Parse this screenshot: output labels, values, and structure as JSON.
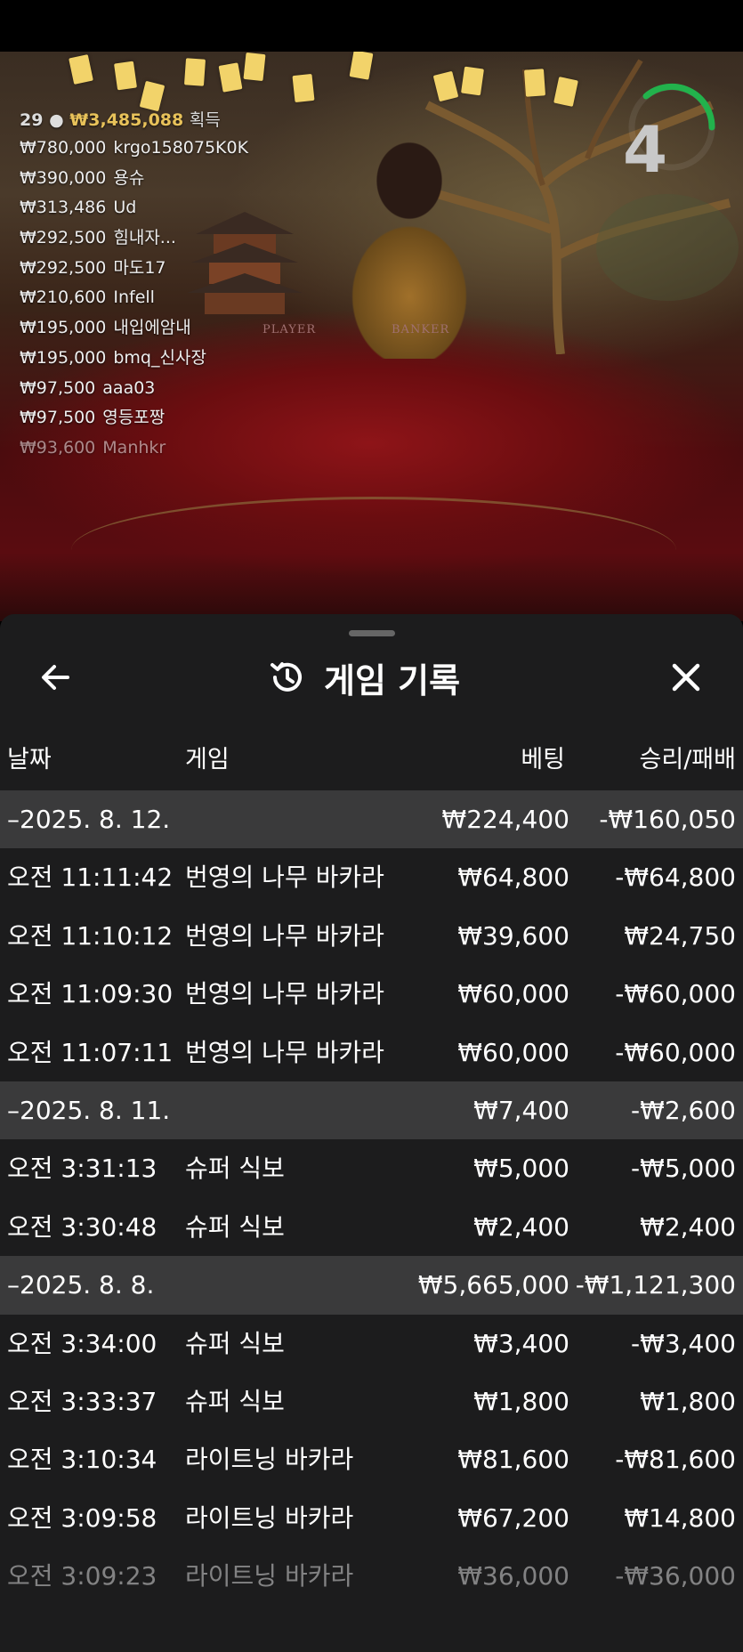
{
  "live": {
    "winners_count": "29",
    "winners_total": "₩3,485,088",
    "winners_label": "획득",
    "countdown": "4",
    "table_labels": [
      "PLAYER",
      "BANKER"
    ],
    "winners": [
      {
        "amount": "₩780,000",
        "name": "krgo158075K0K"
      },
      {
        "amount": "₩390,000",
        "name": "용슈"
      },
      {
        "amount": "₩313,486",
        "name": "Ud"
      },
      {
        "amount": "₩292,500",
        "name": "힘내자..."
      },
      {
        "amount": "₩292,500",
        "name": "마도17"
      },
      {
        "amount": "₩210,600",
        "name": "Infell"
      },
      {
        "amount": "₩195,000",
        "name": "내입에암내"
      },
      {
        "amount": "₩195,000",
        "name": "bmq_신사장"
      },
      {
        "amount": "₩97,500",
        "name": "aaa03"
      },
      {
        "amount": "₩97,500",
        "name": "영등포짱"
      },
      {
        "amount": "₩93,600",
        "name": "Manhkr"
      }
    ]
  },
  "panel": {
    "title": "게임 기록",
    "back_icon": "arrow-left-icon",
    "history_icon": "history-clock-icon",
    "close_icon": "close-icon",
    "columns": {
      "date": "날짜",
      "game": "게임",
      "bet": "베팅",
      "result": "승리/패배"
    },
    "rows": [
      {
        "type": "date",
        "time": "–2025. 8. 12.",
        "game": "",
        "bet": "₩224,400",
        "result": "-₩160,050"
      },
      {
        "type": "game",
        "time": "오전 11:11:42",
        "game": "번영의 나무 바카라",
        "bet": "₩64,800",
        "result": "-₩64,800"
      },
      {
        "type": "game",
        "time": "오전 11:10:12",
        "game": "번영의 나무 바카라",
        "bet": "₩39,600",
        "result": "₩24,750"
      },
      {
        "type": "game",
        "time": "오전 11:09:30",
        "game": "번영의 나무 바카라",
        "bet": "₩60,000",
        "result": "-₩60,000"
      },
      {
        "type": "game",
        "time": "오전 11:07:11",
        "game": "번영의 나무 바카라",
        "bet": "₩60,000",
        "result": "-₩60,000"
      },
      {
        "type": "date",
        "time": "–2025. 8. 11.",
        "game": "",
        "bet": "₩7,400",
        "result": "-₩2,600"
      },
      {
        "type": "game",
        "time": "오전 3:31:13",
        "game": "슈퍼 식보",
        "bet": "₩5,000",
        "result": "-₩5,000"
      },
      {
        "type": "game",
        "time": "오전 3:30:48",
        "game": "슈퍼 식보",
        "bet": "₩2,400",
        "result": "₩2,400"
      },
      {
        "type": "date",
        "time": "–2025. 8. 8.",
        "game": "",
        "bet": "₩5,665,000",
        "result": "-₩1,121,300"
      },
      {
        "type": "game",
        "time": "오전 3:34:00",
        "game": "슈퍼 식보",
        "bet": "₩3,400",
        "result": "-₩3,400"
      },
      {
        "type": "game",
        "time": "오전 3:33:37",
        "game": "슈퍼 식보",
        "bet": "₩1,800",
        "result": "₩1,800"
      },
      {
        "type": "game",
        "time": "오전 3:10:34",
        "game": "라이트닝 바카라",
        "bet": "₩81,600",
        "result": "-₩81,600"
      },
      {
        "type": "game",
        "time": "오전 3:09:58",
        "game": "라이트닝 바카라",
        "bet": "₩67,200",
        "result": "₩14,800"
      },
      {
        "type": "game",
        "time": "오전 3:09:23",
        "game": "라이트닝 바카라",
        "bet": "₩36,000",
        "result": "-₩36,000"
      }
    ]
  }
}
